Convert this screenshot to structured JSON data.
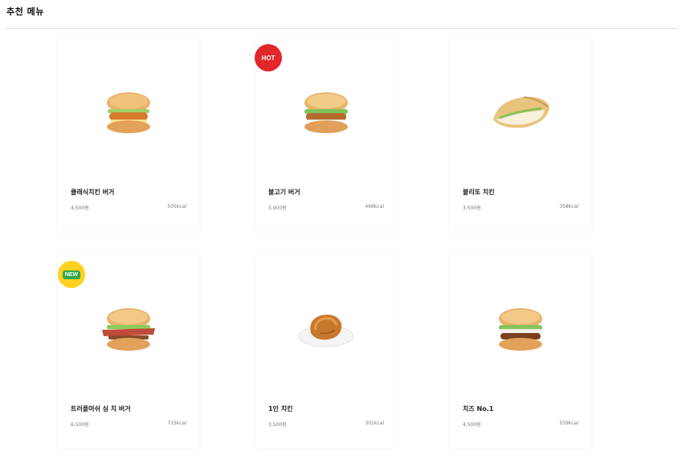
{
  "section": {
    "title": "추천 메뉴"
  },
  "menu": [
    {
      "name": "클래식치킨 버거",
      "price": "4,500원",
      "kcal": "505kcal",
      "badge": "",
      "icon": "chicken-burger-icon"
    },
    {
      "name": "불고기 버거",
      "price": "3,900원",
      "kcal": "466kcal",
      "badge": "HOT",
      "icon": "bulgogi-burger-icon"
    },
    {
      "name": "불리또 치킨",
      "price": "3,500원",
      "kcal": "358kcal",
      "badge": "",
      "icon": "burrito-icon"
    },
    {
      "name": "트러플머쉬 싱 치 버거",
      "price": "6,500원",
      "kcal": "715kcal",
      "badge": "NEW",
      "icon": "bacon-burger-icon"
    },
    {
      "name": "1인 치킨",
      "price": "3,500원",
      "kcal": "301kcal",
      "badge": "",
      "icon": "fried-chicken-icon"
    },
    {
      "name": "치즈 No.1",
      "price": "4,500원",
      "kcal": "559kcal",
      "badge": "",
      "icon": "cheese-burger-icon"
    }
  ],
  "colors": {
    "hot": "#e1262c",
    "new_outer": "#ffd21f",
    "new_inner": "#30a64a"
  }
}
